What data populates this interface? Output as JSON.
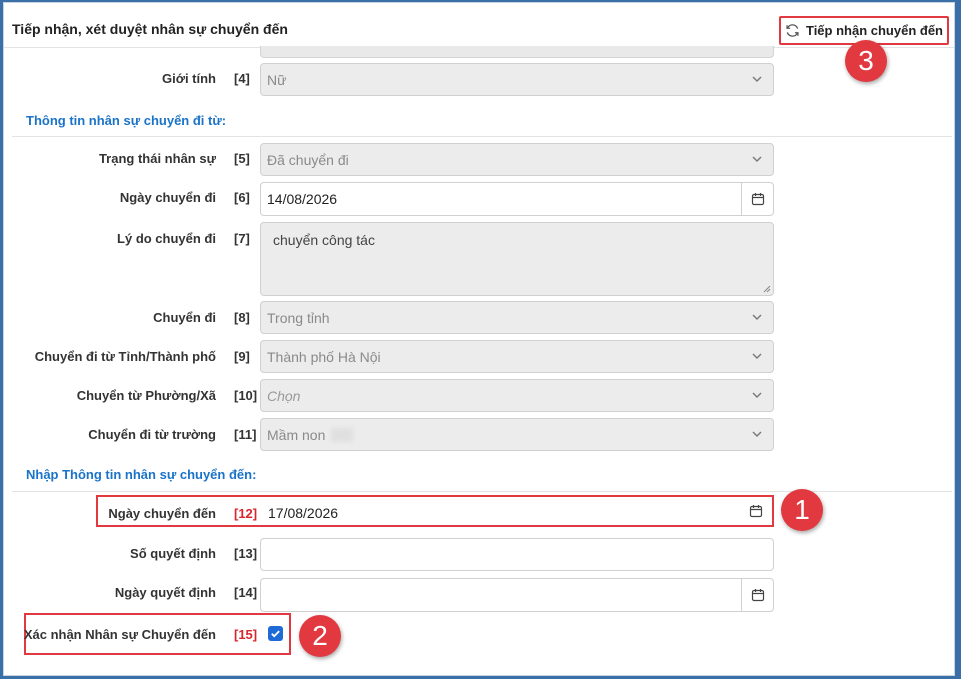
{
  "header": {
    "title": "Tiếp nhận, xét duyệt nhân sự chuyển đến",
    "receive_button": "Tiếp nhận chuyển đến"
  },
  "gender": {
    "label": "Giới tính",
    "num": "[4]",
    "value": "Nữ"
  },
  "section_from": "Thông tin nhân sự chuyển đi từ:",
  "status": {
    "label": "Trạng thái nhân sự",
    "num": "[5]",
    "value": "Đã chuyển đi"
  },
  "leave_date": {
    "label": "Ngày chuyển đi",
    "num": "[6]",
    "value": "14/08/2026"
  },
  "reason": {
    "label": "Lý do chuyển đi",
    "num": "[7]",
    "value": "chuyển công tác"
  },
  "transfer_scope": {
    "label": "Chuyển đi",
    "num": "[8]",
    "value": "Trong tỉnh"
  },
  "from_province": {
    "label": "Chuyển đi từ Tỉnh/Thành phố",
    "num": "[9]",
    "value": "Thành phố Hà Nội"
  },
  "from_ward": {
    "label": "Chuyển từ Phường/Xã",
    "num": "[10]",
    "placeholder": "Chọn"
  },
  "from_school": {
    "label": "Chuyển đi từ trường",
    "num": "[11]",
    "value": "Mầm non"
  },
  "section_to": "Nhập Thông tin nhân sự chuyển đến:",
  "arrive_date": {
    "label": "Ngày chuyển đến",
    "num": "[12]",
    "value": "17/08/2026"
  },
  "decision_no": {
    "label": "Số quyết định",
    "num": "[13]",
    "value": ""
  },
  "decision_date": {
    "label": "Ngày quyết định",
    "num": "[14]",
    "value": ""
  },
  "confirm": {
    "label": "Xác nhận Nhân sự Chuyển đến",
    "num": "[15]",
    "checked": true
  },
  "badges": {
    "b1": "1",
    "b2": "2",
    "b3": "3"
  },
  "colors": {
    "accent_red": "#e2383f",
    "section_blue": "#1a73c8",
    "checkbox_blue": "#1e6ad6"
  }
}
